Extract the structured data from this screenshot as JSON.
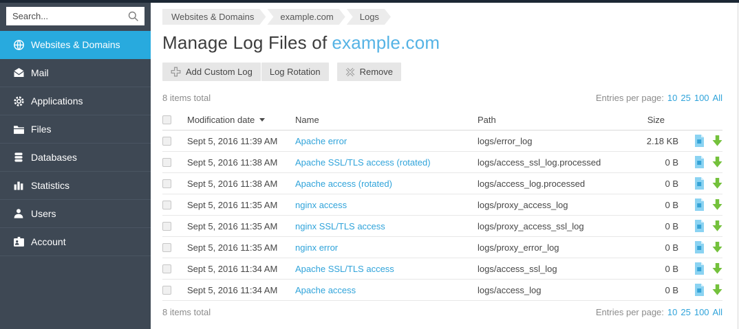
{
  "colors": {
    "accent": "#28aade",
    "link": "#2fa3da",
    "title_accent": "#55b3e5",
    "sidebar_bg": "#3e4854",
    "topstrip": "#1c2734",
    "download_green": "#74c13c",
    "file_blue": "#8bd3f2"
  },
  "sidebar": {
    "search_placeholder": "Search...",
    "items": [
      {
        "label": "Websites & Domains",
        "icon": "globe-icon",
        "active": true
      },
      {
        "label": "Mail",
        "icon": "mail-icon",
        "active": false
      },
      {
        "label": "Applications",
        "icon": "gear-icon",
        "active": false
      },
      {
        "label": "Files",
        "icon": "folder-icon",
        "active": false
      },
      {
        "label": "Databases",
        "icon": "database-icon",
        "active": false
      },
      {
        "label": "Statistics",
        "icon": "bar-chart-icon",
        "active": false
      },
      {
        "label": "Users",
        "icon": "user-icon",
        "active": false
      },
      {
        "label": "Account",
        "icon": "id-card-icon",
        "active": false
      }
    ]
  },
  "breadcrumb": {
    "items": [
      "Websites & Domains",
      "example.com",
      "Logs"
    ]
  },
  "header": {
    "title_prefix": "Manage Log Files of",
    "domain": "example.com"
  },
  "toolbar": {
    "add_custom_log": "Add Custom Log",
    "log_rotation": "Log Rotation",
    "remove": "Remove"
  },
  "list": {
    "items_total": "8 items total",
    "entries_per_page_label": "Entries per page:",
    "page_size_options": [
      "10",
      "25",
      "100",
      "All"
    ],
    "columns": {
      "modification_date": "Modification date",
      "name": "Name",
      "path": "Path",
      "size": "Size"
    },
    "rows": [
      {
        "date": "Sept 5, 2016 11:39 AM",
        "name": "Apache error",
        "path": "logs/error_log",
        "size": "2.18 KB"
      },
      {
        "date": "Sept 5, 2016 11:38 AM",
        "name": "Apache SSL/TLS access (rotated)",
        "path": "logs/access_ssl_log.processed",
        "size": "0 B"
      },
      {
        "date": "Sept 5, 2016 11:38 AM",
        "name": "Apache access (rotated)",
        "path": "logs/access_log.processed",
        "size": "0 B"
      },
      {
        "date": "Sept 5, 2016 11:35 AM",
        "name": "nginx access",
        "path": "logs/proxy_access_log",
        "size": "0 B"
      },
      {
        "date": "Sept 5, 2016 11:35 AM",
        "name": "nginx SSL/TLS access",
        "path": "logs/proxy_access_ssl_log",
        "size": "0 B"
      },
      {
        "date": "Sept 5, 2016 11:35 AM",
        "name": "nginx error",
        "path": "logs/proxy_error_log",
        "size": "0 B"
      },
      {
        "date": "Sept 5, 2016 11:34 AM",
        "name": "Apache SSL/TLS access",
        "path": "logs/access_ssl_log",
        "size": "0 B"
      },
      {
        "date": "Sept 5, 2016 11:34 AM",
        "name": "Apache access",
        "path": "logs/access_log",
        "size": "0 B"
      }
    ]
  }
}
